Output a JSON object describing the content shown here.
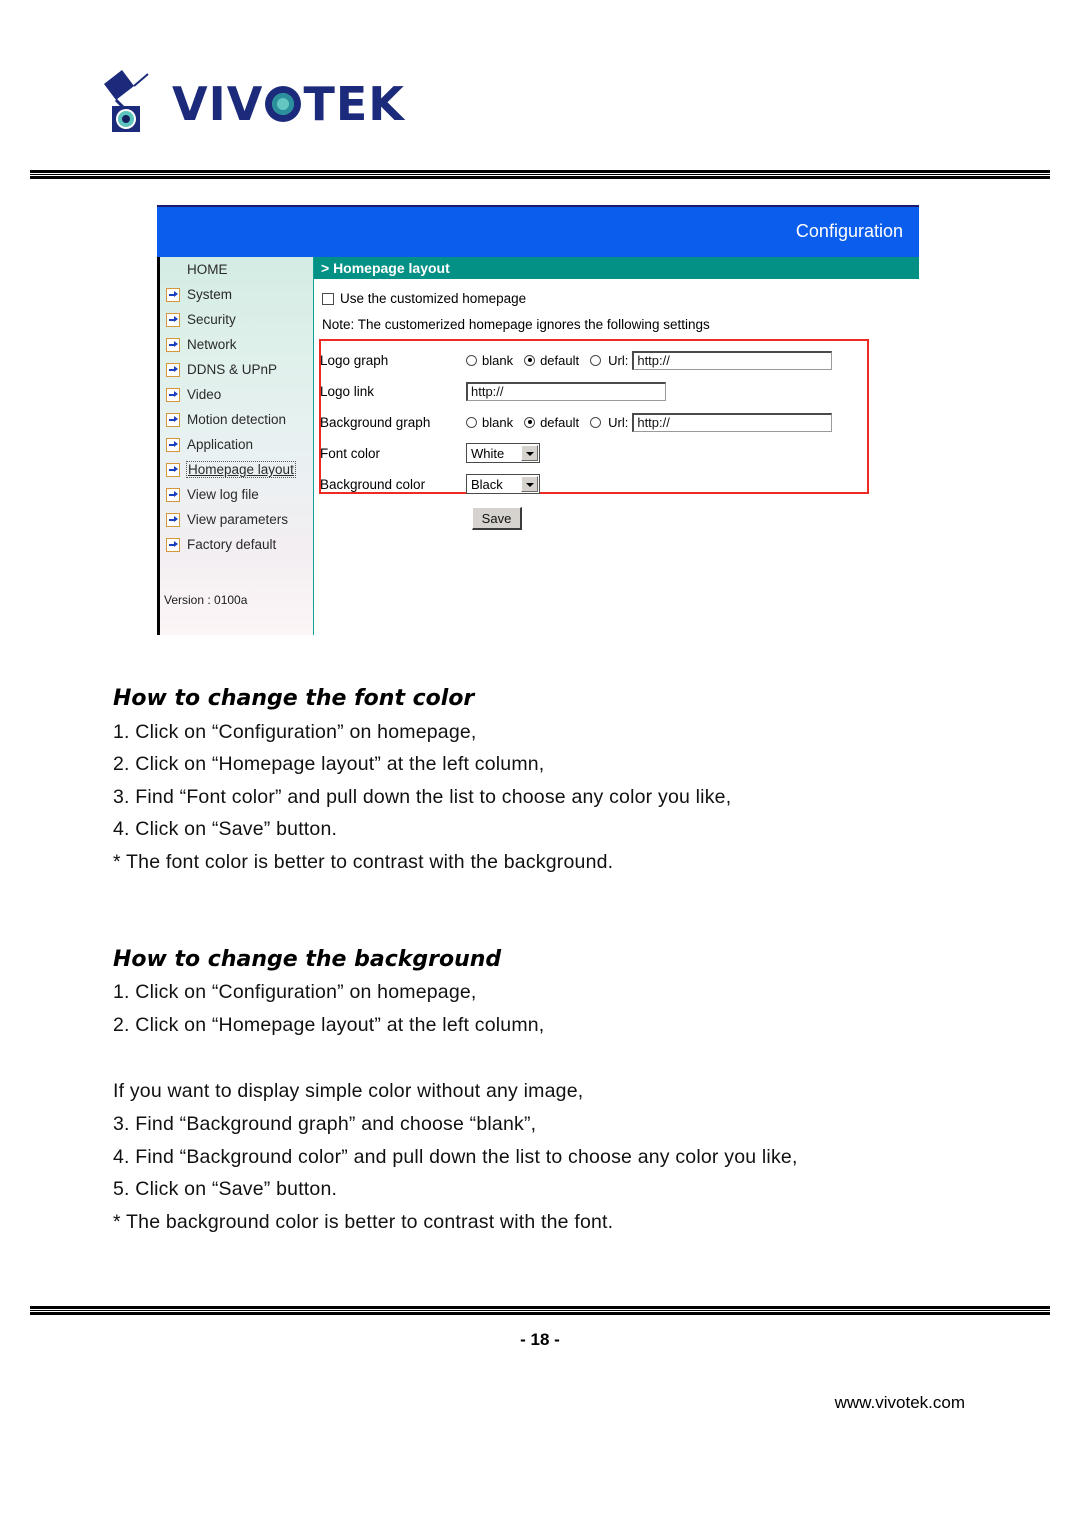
{
  "brand": {
    "wordmark_pre": "VIV",
    "wordmark_o": "O",
    "wordmark_post": "TEK",
    "logo_icon": "security-camera-icon",
    "navy": "#1b2a7a",
    "teal": "#2b8f9c"
  },
  "screenshot": {
    "window_title": "Configuration",
    "breadcrumb": "> Homepage layout",
    "header_blue": "#0b5ded",
    "band_teal": "#049185",
    "highlight_red": "#ee2a24",
    "sidebar": {
      "items": [
        {
          "label": "HOME",
          "has_arrow": false,
          "selected": false
        },
        {
          "label": "System",
          "has_arrow": true,
          "selected": false
        },
        {
          "label": "Security",
          "has_arrow": true,
          "selected": false
        },
        {
          "label": "Network",
          "has_arrow": true,
          "selected": false
        },
        {
          "label": "DDNS & UPnP",
          "has_arrow": true,
          "selected": false
        },
        {
          "label": "Video",
          "has_arrow": true,
          "selected": false
        },
        {
          "label": "Motion detection",
          "has_arrow": true,
          "selected": false
        },
        {
          "label": "Application",
          "has_arrow": true,
          "selected": false
        },
        {
          "label": "Homepage layout",
          "has_arrow": true,
          "selected": true
        },
        {
          "label": "View log file",
          "has_arrow": true,
          "selected": false
        },
        {
          "label": "View parameters",
          "has_arrow": true,
          "selected": false
        },
        {
          "label": "Factory default",
          "has_arrow": true,
          "selected": false
        }
      ],
      "version": "Version : 0100a"
    },
    "form": {
      "checkbox_label": "Use the customized homepage",
      "checkbox_checked": false,
      "note": "Note: The customerized homepage ignores the following settings",
      "logo_graph": {
        "label": "Logo graph",
        "opt_blank": "blank",
        "opt_default": "default",
        "opt_url": "Url:",
        "selected": "default",
        "url_value": "http://"
      },
      "logo_link": {
        "label": "Logo link",
        "value": "http://"
      },
      "background_graph": {
        "label": "Background graph",
        "opt_blank": "blank",
        "opt_default": "default",
        "opt_url": "Url:",
        "selected": "default",
        "url_value": "http://"
      },
      "font_color": {
        "label": "Font color",
        "value": "White"
      },
      "background_color": {
        "label": "Background color",
        "value": "Black"
      },
      "save_label": "Save"
    }
  },
  "sections": [
    {
      "heading": "How to change the font color",
      "lines": [
        "1. Click on “Configuration” on homepage,",
        "2. Click on “Homepage layout” at the left column,",
        "3. Find “Font color” and pull down the list to choose any color you like,",
        "4. Click on “Save” button.",
        "*  The font color is better to contrast with the background."
      ]
    },
    {
      "heading": "How to change the background",
      "lines": [
        "1. Click on “Configuration” on homepage,",
        "2. Click on “Homepage layout” at the left column,",
        "",
        "If you want to display simple color without any image,",
        "3. Find “Background graph” and choose “blank”,",
        "4. Find “Background color” and pull down the list to choose any color you like,",
        "5. Click on “Save” button.",
        "*  The background color is better to contrast with the font."
      ]
    }
  ],
  "footer": {
    "page_number": "- 18 -",
    "site": "www.vivotek.com"
  }
}
